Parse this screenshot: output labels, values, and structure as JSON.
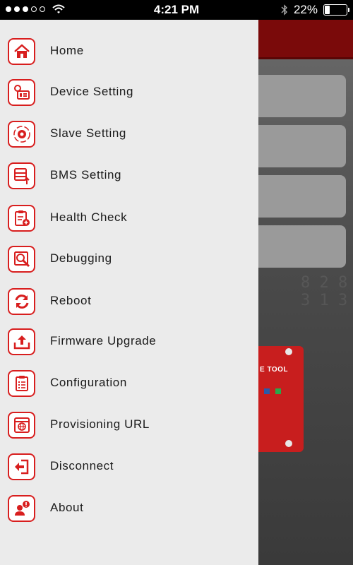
{
  "status_bar": {
    "time": "4:21 PM",
    "battery_text": "22%",
    "battery_level": 0.22,
    "signal_dots": [
      true,
      true,
      true,
      false,
      false
    ],
    "icons": [
      "wifi-icon",
      "bluetooth-icon",
      "battery-icon"
    ]
  },
  "menu": {
    "items": [
      {
        "label": "Home",
        "icon": "home-icon"
      },
      {
        "label": "Device Setting",
        "icon": "device-setting-icon"
      },
      {
        "label": "Slave Setting",
        "icon": "gear-icon"
      },
      {
        "label": "BMS Setting",
        "icon": "bms-icon"
      },
      {
        "label": "Health Check",
        "icon": "clipboard-health-icon"
      },
      {
        "label": "Debugging",
        "icon": "debug-icon"
      },
      {
        "label": "Reboot",
        "icon": "reboot-icon"
      },
      {
        "label": "Firmware Upgrade",
        "icon": "upload-icon"
      },
      {
        "label": "Configuration",
        "icon": "checklist-icon"
      },
      {
        "label": "Provisioning URL",
        "icon": "globe-window-icon"
      },
      {
        "label": "Disconnect",
        "icon": "logout-icon"
      },
      {
        "label": "About",
        "icon": "about-icon"
      }
    ]
  },
  "background": {
    "device_label": "E TOOL"
  },
  "colors": {
    "accent": "#d81e1e",
    "drawer_bg": "#ebebeb",
    "header_red": "#7a0a0a"
  }
}
